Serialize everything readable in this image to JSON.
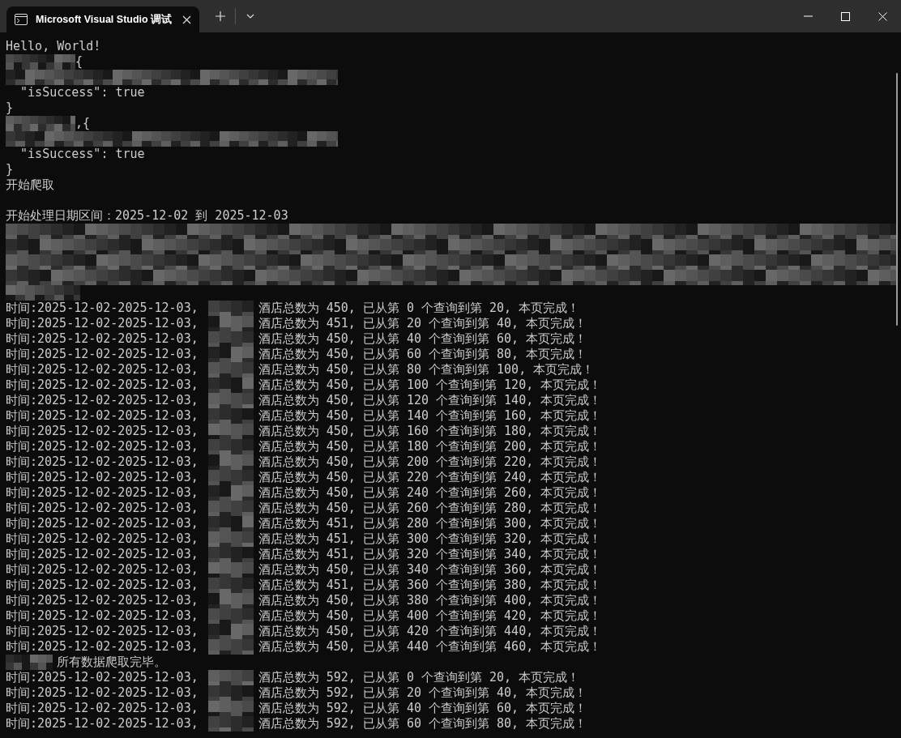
{
  "window": {
    "tab_title": "Microsoft Visual Studio 调试",
    "tab_selected": true
  },
  "console": {
    "lines": [
      {
        "kind": "text",
        "text": "Hello, World!"
      },
      {
        "kind": "masked_text",
        "text": "{"
      },
      {
        "kind": "masked"
      },
      {
        "kind": "text",
        "text": "  \"isSuccess\": true"
      },
      {
        "kind": "text",
        "text": "}"
      },
      {
        "kind": "masked_text",
        "text": ",{"
      },
      {
        "kind": "masked"
      },
      {
        "kind": "text",
        "text": "  \"isSuccess\": true"
      },
      {
        "kind": "text",
        "text": "}"
      },
      {
        "kind": "text",
        "text": "开始爬取"
      },
      {
        "kind": "blank"
      },
      {
        "kind": "text",
        "text": "开始处理日期区间：2025-12-02 到 2025-12-03"
      },
      {
        "kind": "masked_wide"
      },
      {
        "kind": "masked_wide"
      },
      {
        "kind": "masked_wide"
      },
      {
        "kind": "masked_wide"
      },
      {
        "kind": "masked_short"
      },
      {
        "kind": "row",
        "prefix": "时间:2025-12-02-2025-12-03,",
        "text": "酒店总数为 450, 已从第 0 个查询到第 20, 本页完成！"
      },
      {
        "kind": "row",
        "prefix": "时间:2025-12-02-2025-12-03,",
        "text": "酒店总数为 451, 已从第 20 个查询到第 40, 本页完成！"
      },
      {
        "kind": "row",
        "prefix": "时间:2025-12-02-2025-12-03,",
        "text": "酒店总数为 450, 已从第 40 个查询到第 60, 本页完成！"
      },
      {
        "kind": "row",
        "prefix": "时间:2025-12-02-2025-12-03,",
        "text": "酒店总数为 450, 已从第 60 个查询到第 80, 本页完成！"
      },
      {
        "kind": "row",
        "prefix": "时间:2025-12-02-2025-12-03,",
        "text": "酒店总数为 450, 已从第 80 个查询到第 100, 本页完成！"
      },
      {
        "kind": "row",
        "prefix": "时间:2025-12-02-2025-12-03,",
        "text": "酒店总数为 450, 已从第 100 个查询到第 120, 本页完成！"
      },
      {
        "kind": "row",
        "prefix": "时间:2025-12-02-2025-12-03,",
        "text": "酒店总数为 450, 已从第 120 个查询到第 140, 本页完成！"
      },
      {
        "kind": "row",
        "prefix": "时间:2025-12-02-2025-12-03,",
        "text": "酒店总数为 450, 已从第 140 个查询到第 160, 本页完成！"
      },
      {
        "kind": "row",
        "prefix": "时间:2025-12-02-2025-12-03,",
        "text": "酒店总数为 450, 已从第 160 个查询到第 180, 本页完成！"
      },
      {
        "kind": "row",
        "prefix": "时间:2025-12-02-2025-12-03,",
        "text": "酒店总数为 450, 已从第 180 个查询到第 200, 本页完成！"
      },
      {
        "kind": "row",
        "prefix": "时间:2025-12-02-2025-12-03,",
        "text": "酒店总数为 450, 已从第 200 个查询到第 220, 本页完成！"
      },
      {
        "kind": "row",
        "prefix": "时间:2025-12-02-2025-12-03,",
        "text": "酒店总数为 450, 已从第 220 个查询到第 240, 本页完成！"
      },
      {
        "kind": "row",
        "prefix": "时间:2025-12-02-2025-12-03,",
        "text": "酒店总数为 450, 已从第 240 个查询到第 260, 本页完成！"
      },
      {
        "kind": "row",
        "prefix": "时间:2025-12-02-2025-12-03,",
        "text": "酒店总数为 450, 已从第 260 个查询到第 280, 本页完成！"
      },
      {
        "kind": "row",
        "prefix": "时间:2025-12-02-2025-12-03,",
        "text": "酒店总数为 451, 已从第 280 个查询到第 300, 本页完成！"
      },
      {
        "kind": "row",
        "prefix": "时间:2025-12-02-2025-12-03,",
        "text": "酒店总数为 451, 已从第 300 个查询到第 320, 本页完成！"
      },
      {
        "kind": "row",
        "prefix": "时间:2025-12-02-2025-12-03,",
        "text": "酒店总数为 451, 已从第 320 个查询到第 340, 本页完成！"
      },
      {
        "kind": "row",
        "prefix": "时间:2025-12-02-2025-12-03,",
        "text": "酒店总数为 450, 已从第 340 个查询到第 360, 本页完成！"
      },
      {
        "kind": "row",
        "prefix": "时间:2025-12-02-2025-12-03,",
        "text": "酒店总数为 451, 已从第 360 个查询到第 380, 本页完成！"
      },
      {
        "kind": "row",
        "prefix": "时间:2025-12-02-2025-12-03,",
        "text": "酒店总数为 450, 已从第 380 个查询到第 400, 本页完成！"
      },
      {
        "kind": "row",
        "prefix": "时间:2025-12-02-2025-12-03,",
        "text": "酒店总数为 450, 已从第 400 个查询到第 420, 本页完成！"
      },
      {
        "kind": "row",
        "prefix": "时间:2025-12-02-2025-12-03,",
        "text": "酒店总数为 450, 已从第 420 个查询到第 440, 本页完成！"
      },
      {
        "kind": "row",
        "prefix": "时间:2025-12-02-2025-12-03,",
        "text": "酒店总数为 450, 已从第 440 个查询到第 460, 本页完成！"
      },
      {
        "kind": "masked_lead",
        "text": "所有数据爬取完毕。"
      },
      {
        "kind": "row",
        "prefix": "时间:2025-12-02-2025-12-03,",
        "text": "酒店总数为 592, 已从第 0 个查询到第 20, 本页完成！"
      },
      {
        "kind": "row",
        "prefix": "时间:2025-12-02-2025-12-03,",
        "text": "酒店总数为 592, 已从第 20 个查询到第 40, 本页完成！"
      },
      {
        "kind": "row",
        "prefix": "时间:2025-12-02-2025-12-03,",
        "text": "酒店总数为 592, 已从第 40 个查询到第 60, 本页完成！"
      },
      {
        "kind": "row",
        "prefix": "时间:2025-12-02-2025-12-03,",
        "text": "酒店总数为 592, 已从第 60 个查询到第 80, 本页完成！"
      }
    ]
  }
}
